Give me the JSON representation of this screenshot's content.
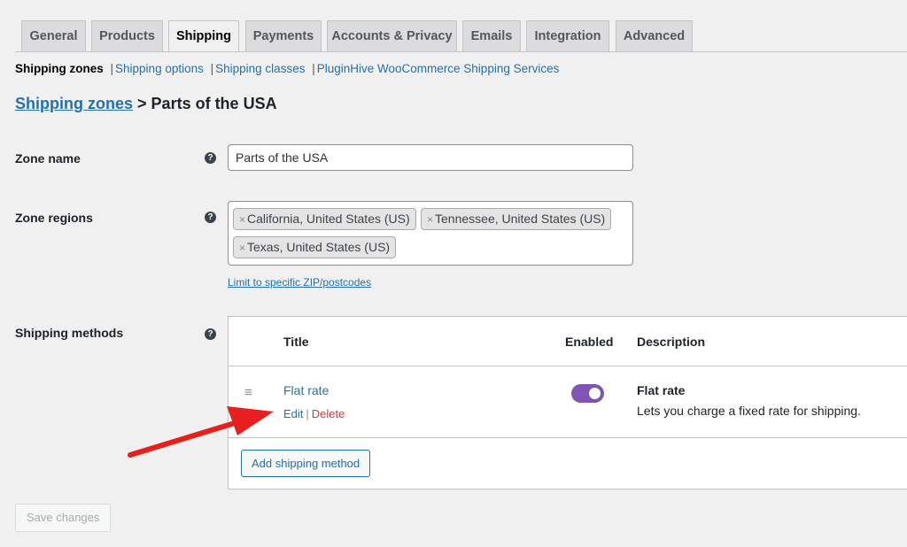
{
  "tabs": [
    {
      "label": "General",
      "active": false
    },
    {
      "label": "Products",
      "active": false
    },
    {
      "label": "Shipping",
      "active": true
    },
    {
      "label": "Payments",
      "active": false
    },
    {
      "label": "Accounts & Privacy",
      "active": false
    },
    {
      "label": "Emails",
      "active": false
    },
    {
      "label": "Integration",
      "active": false
    },
    {
      "label": "Advanced",
      "active": false
    }
  ],
  "subnav": [
    {
      "label": "Shipping zones",
      "current": true
    },
    {
      "label": "Shipping options",
      "current": false
    },
    {
      "label": "Shipping classes",
      "current": false
    },
    {
      "label": "PluginHive WooCommerce Shipping Services",
      "current": false
    }
  ],
  "subnav_separator": "|",
  "breadcrumb": {
    "link": "Shipping zones",
    "separator": ">",
    "current": "Parts of the USA"
  },
  "form": {
    "zone_name_label": "Zone name",
    "zone_name_value": "Parts of the USA",
    "zone_regions_label": "Zone regions",
    "regions": [
      "California, United States (US)",
      "Tennessee, United States (US)",
      "Texas, United States (US)"
    ],
    "chip_remove": "×",
    "limit_link": "Limit to specific ZIP/postcodes",
    "shipping_methods_label": "Shipping methods",
    "help_glyph": "?"
  },
  "methods_table": {
    "headers": {
      "title": "Title",
      "enabled": "Enabled",
      "description": "Description"
    },
    "rows": [
      {
        "title": "Flat rate",
        "edit": "Edit",
        "delete": "Delete",
        "action_sep": "|",
        "enabled": true,
        "desc_title": "Flat rate",
        "desc_text": "Lets you charge a fixed rate for shipping."
      }
    ],
    "drag_glyph": "≡",
    "add_button": "Add shipping method"
  },
  "save_button": "Save changes",
  "colors": {
    "accent": "#2271b1",
    "toggle": "#7f54b3",
    "delete": "#d63638",
    "arrow": "#e8201d"
  },
  "icons": {
    "help": "question-circle-icon",
    "drag": "drag-handle-icon",
    "remove": "close-icon"
  }
}
